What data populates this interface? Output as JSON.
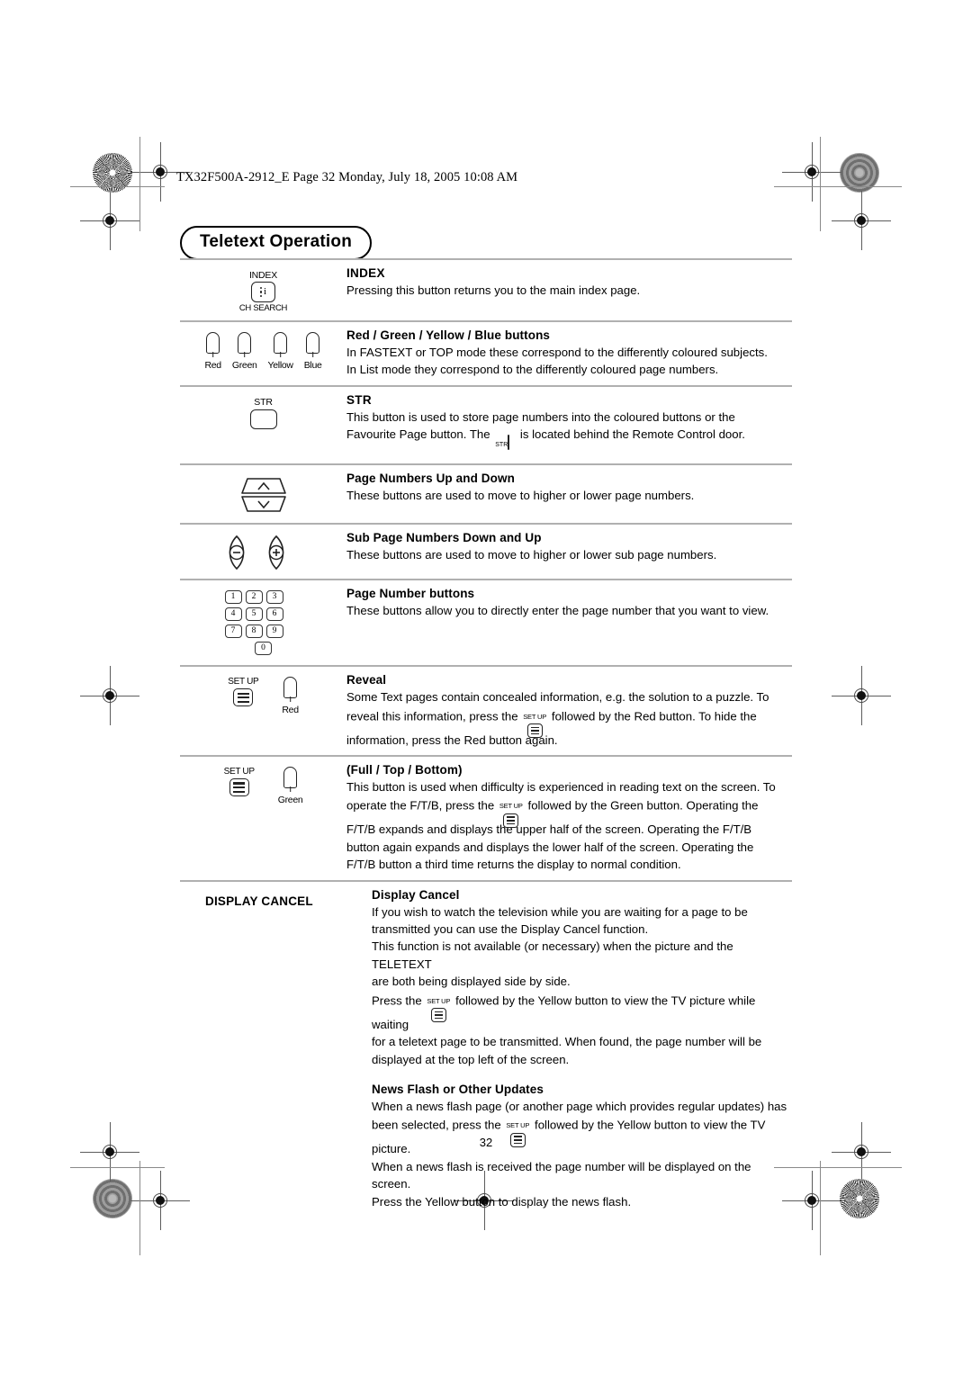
{
  "print_marks": {
    "file_line": "TX32F500A-2912_E  Page 32  Monday, July 18, 2005  10:08 AM"
  },
  "chapter": {
    "title": "Teletext Operation"
  },
  "page_number": "32",
  "sections": [
    {
      "id": "index",
      "icon": {
        "type": "index-button",
        "top_label": "INDEX",
        "bottom_label": "CH SEARCH",
        "glyph": "i"
      },
      "heading": "INDEX",
      "paragraphs": [
        "Pressing this button returns you to the main index page."
      ]
    },
    {
      "id": "colour-buttons",
      "icon": {
        "type": "colour-buttons",
        "buttons": [
          {
            "name": "Red"
          },
          {
            "name": "Green"
          },
          {
            "name": "Yellow"
          },
          {
            "name": "Blue"
          }
        ]
      },
      "heading": "Red / Green / Yellow / Blue buttons",
      "paragraphs": [
        "In FASTEXT or TOP mode these correspond to the differently coloured subjects.",
        "In List mode they correspond to the differently coloured page numbers."
      ]
    },
    {
      "id": "str",
      "icon": {
        "type": "str-button",
        "label": "STR"
      },
      "heading": "STR",
      "paragraphs": [
        "This button is used to store page numbers into the coloured buttons or the"
      ],
      "rich_paragraph": {
        "before": "Favourite Page button. The",
        "icon": "str-mini-icon",
        "icon_label": "STR",
        "after": "is located behind the Remote Control door."
      }
    },
    {
      "id": "page-up-down",
      "icon": {
        "type": "rocker-updown",
        "up": "∧",
        "down": "∨"
      },
      "heading": "Page Numbers Up and Down",
      "paragraphs": [
        "These buttons are used to move to higher or lower page numbers."
      ]
    },
    {
      "id": "sub-page",
      "icon": {
        "type": "subpage-buttons",
        "minus": "−",
        "plus": "+"
      },
      "heading": "Sub Page Numbers Down and Up",
      "paragraphs": [
        "These buttons are used to move to higher or lower sub page numbers."
      ]
    },
    {
      "id": "page-number-buttons",
      "icon": {
        "type": "keypad",
        "rows": [
          [
            "1",
            "2",
            "3"
          ],
          [
            "4",
            "5",
            "6"
          ],
          [
            "7",
            "8",
            "9"
          ],
          [
            "0"
          ]
        ]
      },
      "heading": "Page Number buttons",
      "paragraphs": [
        "These buttons allow you to directly enter the page number that you want to view."
      ]
    },
    {
      "id": "reveal",
      "icon": {
        "type": "setup-plus-colour",
        "setup_label": "SET UP",
        "colour_name": "Red"
      },
      "heading": "Reveal",
      "paragraphs": [
        "Some Text pages contain concealed information, e.g. the solution to a puzzle. To"
      ],
      "rich_paragraph": {
        "before": "reveal this information, press the",
        "icon": "setup-mini-icon",
        "icon_label": "SET UP",
        "after": "followed by the Red button. To hide the"
      },
      "paragraphs_after": [
        "information, press the Red button again."
      ]
    },
    {
      "id": "full-top-bottom",
      "icon": {
        "type": "setup-plus-colour",
        "setup_label": "SET UP",
        "colour_name": "Green"
      },
      "heading": "(Full / Top / Bottom)",
      "paragraphs": [
        "This button is used when difficulty is experienced in reading text on the screen. To"
      ],
      "rich_paragraph": {
        "before": "operate the F/T/B, press the",
        "icon": "setup-mini-icon",
        "icon_label": "SET UP",
        "after": "followed by the Green button. Operating the"
      },
      "paragraphs_after": [
        "F/T/B expands and displays the upper half of the screen. Operating the F/T/B",
        "button again expands and displays the lower half of the screen. Operating the",
        "F/T/B button a third time returns the display to normal condition."
      ]
    },
    {
      "id": "display-cancel",
      "icon": {
        "type": "text-label",
        "label": "DISPLAY CANCEL"
      },
      "heading": "Display Cancel",
      "paragraphs": [
        "If you wish to watch the television while you are waiting for a page to be",
        "transmitted you can use the Display Cancel function.",
        "This function is not available (or necessary) when the picture and the TELETEXT",
        "are both being displayed side by side."
      ],
      "rich_paragraph": {
        "before": "Press the",
        "icon": "setup-mini-icon",
        "icon_label": "SET UP",
        "after": "followed by the Yellow button to view the TV picture while waiting"
      },
      "paragraphs_after": [
        "for a teletext page to be transmitted. When found, the page number will be",
        "displayed at the top left of the screen."
      ]
    },
    {
      "id": "news-flash",
      "icon": {
        "type": "none"
      },
      "heading": "News Flash or Other Updates",
      "paragraphs": [
        "When a news flash page (or another page which provides regular updates) has"
      ],
      "rich_paragraph": {
        "before": "been selected, press the",
        "icon": "setup-mini-icon",
        "icon_label": "SET UP",
        "after": "followed by the Yellow button to view the TV picture."
      },
      "paragraphs_after": [
        "When a news flash is received the page number will be displayed on the screen.",
        "Press the Yellow button to display the news flash."
      ]
    }
  ]
}
